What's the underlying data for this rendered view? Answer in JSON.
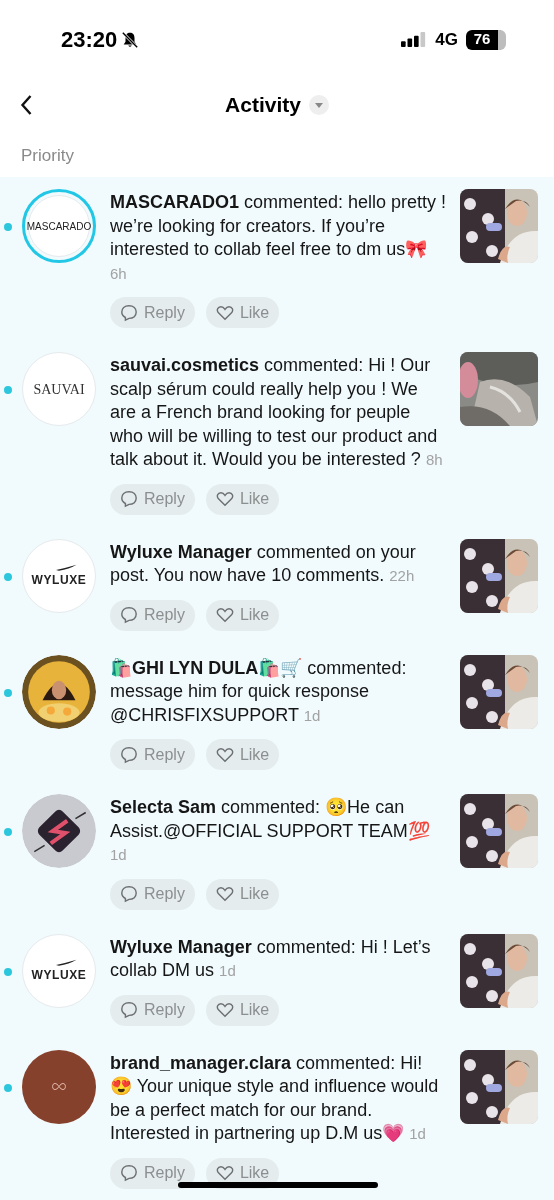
{
  "status_bar": {
    "time": "23:20",
    "silenced": true,
    "network": "4G",
    "battery": "76"
  },
  "header": {
    "title": "Activity"
  },
  "section": "Priority",
  "notifications": [
    {
      "name": "MASCARADO1",
      "text": " commented: hello pretty ! we’re looking for creators. If you’re interested to collab feel free to dm us🎀",
      "time": "6h",
      "unread": true,
      "story": true,
      "avatar": {
        "kind": "wordmark",
        "label": "MASCARADO"
      },
      "reply": "Reply",
      "like": "Like"
    },
    {
      "name": "sauvai.cosmetics",
      "text": " commented: Hi ! Our scalp sérum could really help you ! We are a French brand looking for peuple who will be willing to test our product and talk about it. Would you be interested ?",
      "time": "8h",
      "unread": true,
      "story": false,
      "avatar": {
        "kind": "seriflogo",
        "label": "SAUVAI"
      },
      "reply": "Reply",
      "like": "Like"
    },
    {
      "name": "Wyluxe Manager",
      "text": " commented on your post. You now have 10 comments.",
      "time": "22h",
      "unread": true,
      "story": false,
      "avatar": {
        "kind": "winglogo",
        "label": "WYLUXE"
      },
      "reply": "Reply",
      "like": "Like"
    },
    {
      "name": "🛍️GHI LYN DULA🛍️🛒",
      "text": " commented: message him for quick response @CHRISFIXSUPPORT",
      "time": "1d",
      "unread": true,
      "story": false,
      "reply": "Reply",
      "like": "Like"
    },
    {
      "name": "Selecta Sam",
      "text": " commented: 🥺He can Assist.@OFFICIAL SUPPORT TEAM💯",
      "time": "1d",
      "unread": true,
      "story": false,
      "avatar": {
        "kind": "emblem"
      },
      "reply": "Reply",
      "like": "Like"
    },
    {
      "name": "Wyluxe Manager",
      "text": " commented: Hi ! Let’s collab DM us",
      "time": "1d",
      "unread": true,
      "story": false,
      "avatar": {
        "kind": "winglogo",
        "label": "WYLUXE"
      },
      "reply": "Reply",
      "like": "Like"
    },
    {
      "name": "brand_manager.clara",
      "text": " commented: Hi! 😍 Your unique style and influence would be a perfect match for our brand. Interested in partnering up D.M us💗",
      "time": "1d",
      "unread": true,
      "story": false,
      "avatar": {
        "kind": "monogram"
      },
      "reply": "Reply",
      "like": "Like"
    }
  ]
}
